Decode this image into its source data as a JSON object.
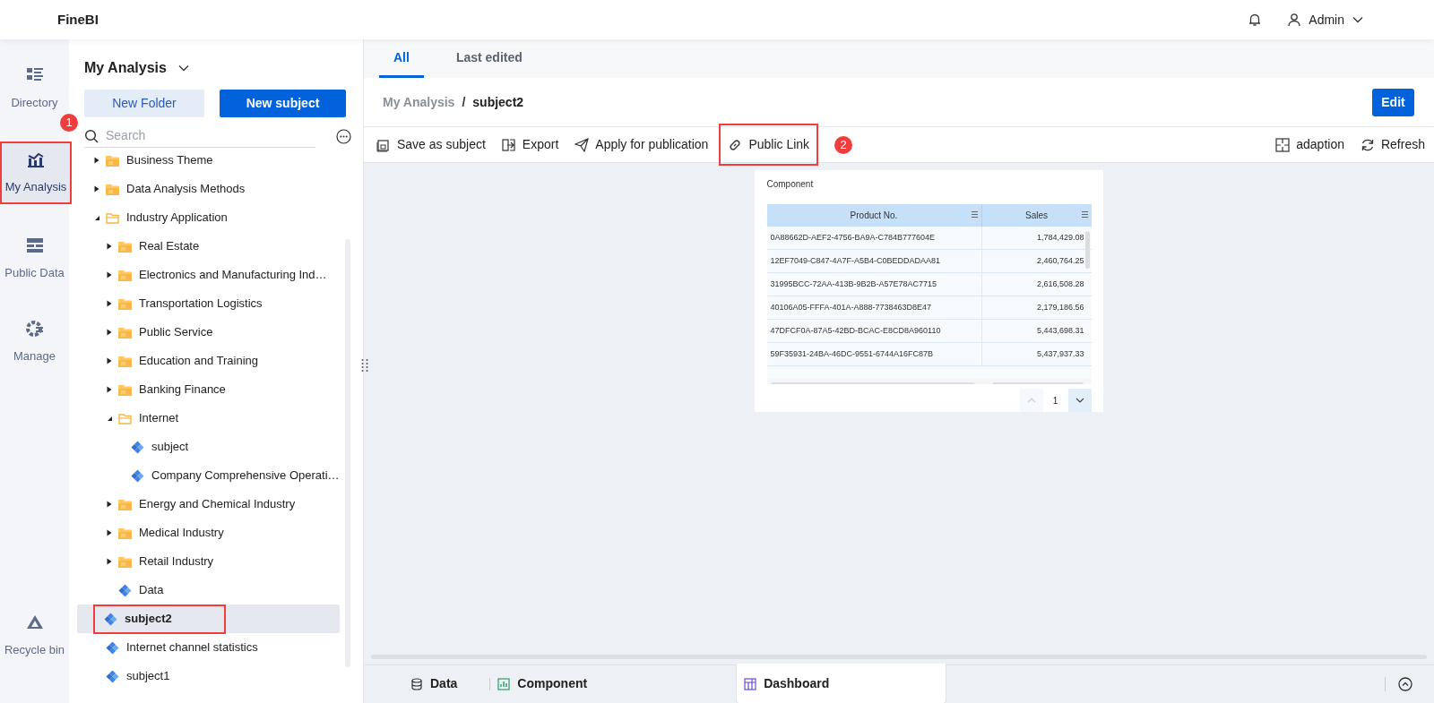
{
  "app": {
    "logo": "FineBI",
    "user": "Admin"
  },
  "nav": [
    {
      "label": "Directory",
      "selected": false,
      "highlighted": false
    },
    {
      "label": "My Analysis",
      "selected": true,
      "highlighted": true,
      "badge": "1"
    },
    {
      "label": "Public Data",
      "selected": false,
      "highlighted": false
    },
    {
      "label": "Manage",
      "selected": false,
      "highlighted": false
    },
    {
      "label": "Recycle bin",
      "selected": false,
      "highlighted": false
    }
  ],
  "panel": {
    "title": "My Analysis",
    "buttons": [
      "New Folder",
      "New subject"
    ],
    "search": {
      "placeholder": "Search"
    }
  },
  "tree": [
    {
      "label": "Business Theme",
      "kind": "folder",
      "expanded": false,
      "selected": false
    },
    {
      "label": "Data Analysis Methods",
      "kind": "folder",
      "expanded": false,
      "selected": false
    },
    {
      "label": "Industry Application",
      "kind": "folder",
      "expanded": true,
      "selected": false,
      "children": [
        {
          "label": "Real Estate",
          "kind": "folder",
          "expanded": false,
          "selected": false
        },
        {
          "label": "Electronics and Manufacturing Ind…",
          "kind": "folder",
          "expanded": false,
          "selected": false
        },
        {
          "label": "Transportation Logistics",
          "kind": "folder",
          "expanded": false,
          "selected": false
        },
        {
          "label": "Public Service",
          "kind": "folder",
          "expanded": false,
          "selected": false
        },
        {
          "label": "Education and Training",
          "kind": "folder",
          "expanded": false,
          "selected": false
        },
        {
          "label": "Banking Finance",
          "kind": "folder",
          "expanded": false,
          "selected": false
        },
        {
          "label": "Internet",
          "kind": "folder",
          "expanded": true,
          "selected": false,
          "children": [
            {
              "label": "subject",
              "kind": "subject",
              "selected": false
            },
            {
              "label": "Company Comprehensive Operati…",
              "kind": "subject",
              "selected": false
            }
          ]
        },
        {
          "label": "Energy and Chemical Industry",
          "kind": "folder",
          "expanded": false,
          "selected": false
        },
        {
          "label": "Medical Industry",
          "kind": "folder",
          "expanded": false,
          "selected": false
        },
        {
          "label": "Retail Industry",
          "kind": "folder",
          "expanded": false,
          "selected": false
        },
        {
          "label": "Data",
          "kind": "subject",
          "selected": false
        }
      ]
    },
    {
      "label": "subject2",
      "kind": "subject",
      "selected": true,
      "highlighted": true
    },
    {
      "label": "Internet channel statistics",
      "kind": "subject",
      "selected": false
    },
    {
      "label": "subject1",
      "kind": "subject",
      "selected": false
    }
  ],
  "tabs": [
    {
      "label": "All",
      "selected": true
    },
    {
      "label": "Last edited",
      "selected": false
    }
  ],
  "breadcrumb": {
    "items": [
      "My Analysis",
      "subject2"
    ],
    "separator": "/"
  },
  "edit_button": "Edit",
  "toolbar": [
    {
      "label": "Save as subject",
      "highlighted": false
    },
    {
      "label": "Export",
      "highlighted": false
    },
    {
      "label": "Apply for publication",
      "highlighted": false
    },
    {
      "label": "Public Link",
      "highlighted": true,
      "badge": "2"
    }
  ],
  "toolbar_right": [
    {
      "label": "adaption",
      "highlighted": false
    },
    {
      "label": "Refresh",
      "highlighted": false
    }
  ],
  "component": {
    "title": "Component",
    "columns": [
      "Product No.",
      "Sales"
    ],
    "rows": [
      [
        "0A88662D-AEF2-4756-BA9A-C784B777604E",
        "1,784,429.08"
      ],
      [
        "12EF7049-C847-4A7F-A5B4-C0BEDDADAA81",
        "2,460,764.25"
      ],
      [
        "31995BCC-72AA-413B-9B2B-A57E78AC7715",
        "2,616,508.28"
      ],
      [
        "40106A05-FFFA-401A-A888-7738463D8E47",
        "2,179,186.56"
      ],
      [
        "47DFCF0A-87A5-42BD-BCAC-E8CD8A960110",
        "5,443,698.31"
      ],
      [
        "59F35931-24BA-46DC-9551-6744A16FC87B",
        "5,437,937.33"
      ]
    ],
    "page": "1"
  },
  "bottom_tabs": [
    {
      "label": "Data",
      "selected": false
    },
    {
      "label": "Component",
      "selected": false
    },
    {
      "label": "Dashboard",
      "selected": true
    }
  ]
}
